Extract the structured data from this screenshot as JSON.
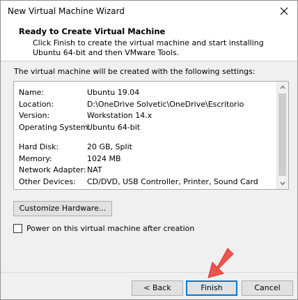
{
  "window": {
    "title": "New Virtual Machine Wizard"
  },
  "header": {
    "title": "Ready to Create Virtual Machine",
    "description": "Click Finish to create the virtual machine and start installing Ubuntu 64-bit and then VMware Tools."
  },
  "settings_caption": "The virtual machine will be created with the following settings:",
  "summary": {
    "items": [
      {
        "key": "Name:",
        "value": "Ubuntu 19.04"
      },
      {
        "key": "Location:",
        "value": "D:\\OneDrive Solvetic\\OneDrive\\Escritorio"
      },
      {
        "key": "Version:",
        "value": "Workstation 14.x"
      },
      {
        "key": "Operating System:",
        "value": "Ubuntu 64-bit"
      },
      {
        "key": "Hard Disk:",
        "value": "20 GB, Split"
      },
      {
        "key": "Memory:",
        "value": "1024 MB"
      },
      {
        "key": "Network Adapter:",
        "value": "NAT"
      },
      {
        "key": "Other Devices:",
        "value": "CD/DVD, USB Controller, Printer, Sound Card"
      }
    ]
  },
  "buttons": {
    "customize": "Customize Hardware...",
    "back": "< Back",
    "finish": "Finish",
    "cancel": "Cancel"
  },
  "power_on_checkbox": {
    "label": "Power on this virtual machine after creation",
    "checked": false
  },
  "colors": {
    "accent": "#0078d7",
    "arrow": "#ef5350"
  }
}
